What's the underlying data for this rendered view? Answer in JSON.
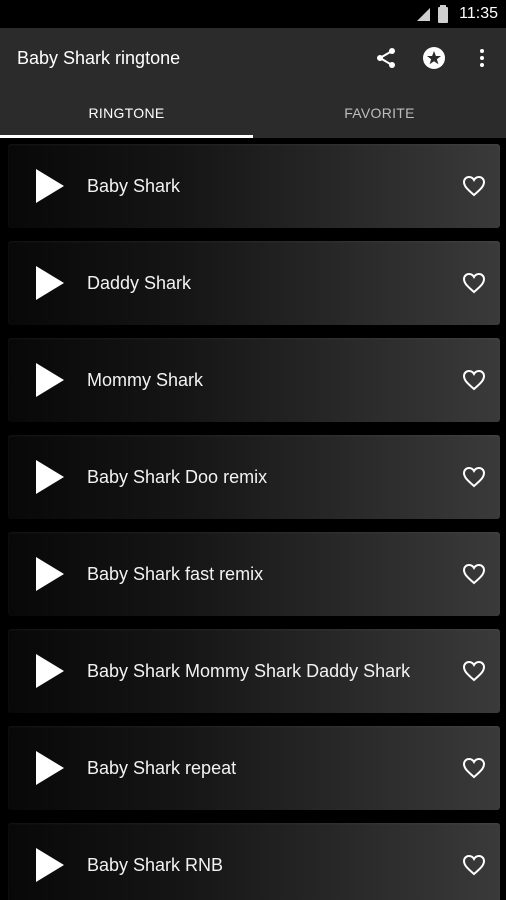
{
  "status_bar": {
    "time": "11:35"
  },
  "app_bar": {
    "title": "Baby Shark ringtone",
    "icons": [
      "share-icon",
      "star-circle-icon",
      "more-vert-icon"
    ]
  },
  "tabs": [
    {
      "label": "RINGTONE",
      "active": true
    },
    {
      "label": "FAVORITE",
      "active": false
    }
  ],
  "ringtones": [
    {
      "title": "Baby Shark"
    },
    {
      "title": "Daddy Shark"
    },
    {
      "title": "Mommy Shark"
    },
    {
      "title": "Baby Shark Doo remix"
    },
    {
      "title": "Baby Shark fast remix"
    },
    {
      "title": "Baby Shark Mommy Shark Daddy Shark"
    },
    {
      "title": "Baby Shark repeat"
    },
    {
      "title": "Baby Shark RNB"
    }
  ],
  "colors": {
    "app_bar": "#2b2b2b",
    "background": "#000000",
    "text": "#ffffff"
  }
}
